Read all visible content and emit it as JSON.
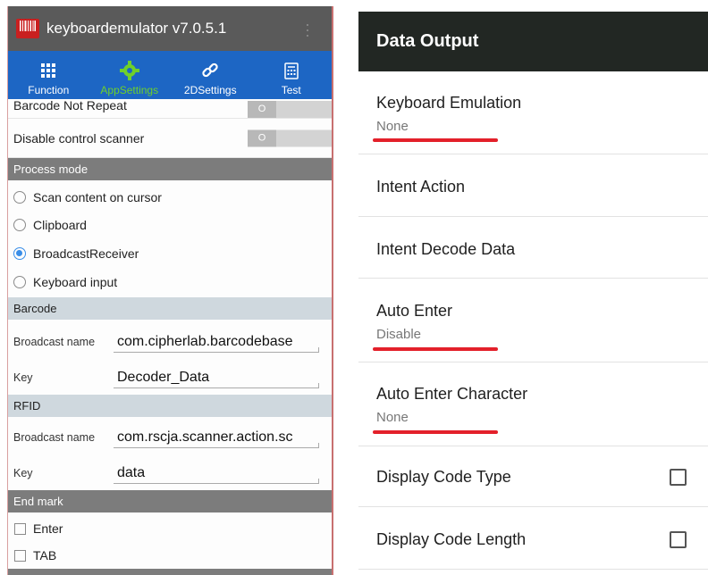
{
  "left": {
    "app_title": "keyboardemulator v7.0.5.1",
    "tabs": [
      {
        "label": "Function",
        "icon": "grid-icon",
        "active": false
      },
      {
        "label": "AppSettings",
        "icon": "gear-icon",
        "active": true
      },
      {
        "label": "2DSettings",
        "icon": "link-icon",
        "active": false
      },
      {
        "label": "Test",
        "icon": "calculator-icon",
        "active": false
      }
    ],
    "barcode_not_repeat": {
      "label": "Barcode Not Repeat",
      "toggle": "O"
    },
    "disable_control_scanner": {
      "label": "Disable control scanner",
      "toggle": "O"
    },
    "process_mode": {
      "header": "Process mode",
      "options": [
        {
          "label": "Scan content on cursor",
          "selected": false
        },
        {
          "label": "Clipboard",
          "selected": false
        },
        {
          "label": "BroadcastReceiver",
          "selected": true
        },
        {
          "label": "Keyboard input",
          "selected": false
        }
      ]
    },
    "barcode": {
      "header": "Barcode",
      "broadcast_name_label": "Broadcast name",
      "broadcast_name_value": "com.cipherlab.barcodebase",
      "key_label": "Key",
      "key_value": "Decoder_Data"
    },
    "rfid": {
      "header": "RFID",
      "broadcast_name_label": "Broadcast name",
      "broadcast_name_value": "com.rscja.scanner.action.sc",
      "key_label": "Key",
      "key_value": "data"
    },
    "end_mark": {
      "header": "End mark",
      "options": [
        {
          "label": "Enter",
          "checked": false
        },
        {
          "label": "TAB",
          "checked": false
        }
      ]
    }
  },
  "right": {
    "header": "Data Output",
    "items": [
      {
        "title": "Keyboard Emulation",
        "value": "None"
      },
      {
        "title": "Intent Action"
      },
      {
        "title": "Intent Decode Data"
      },
      {
        "title": "Auto Enter",
        "value": "Disable"
      },
      {
        "title": "Auto Enter Character",
        "value": "None"
      },
      {
        "title": "Display Code Type",
        "checked": false
      },
      {
        "title": "Display Code Length",
        "checked": false
      }
    ]
  },
  "colors": {
    "tab_bar": "#1d66c4",
    "active_tab": "#6fd02a",
    "title_bar": "#5a5a5a",
    "section_dark": "#7c7c7c",
    "section_light": "#cfd8de",
    "radio_selected": "#3a8ee8",
    "right_header": "#222723",
    "highlight_underline": "#e3202a"
  }
}
